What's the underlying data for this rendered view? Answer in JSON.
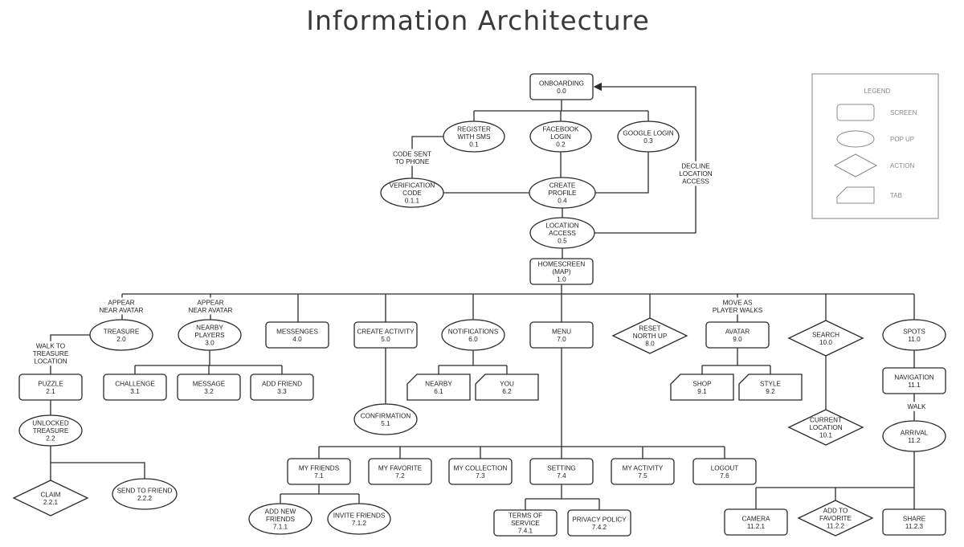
{
  "title": "Information Architecture",
  "legend": {
    "heading": "LEGEND",
    "items": [
      {
        "type": "screen",
        "label": "SCREEN"
      },
      {
        "type": "popup",
        "label": "POP UP"
      },
      {
        "type": "action",
        "label": "ACTION"
      },
      {
        "type": "tab",
        "label": "TAB"
      }
    ]
  },
  "nodes": [
    {
      "id": "0.0",
      "type": "screen",
      "lines": [
        "ONBOARDING",
        "0.0"
      ]
    },
    {
      "id": "0.1",
      "type": "popup",
      "lines": [
        "REGISTER",
        "WITH SMS",
        "0.1"
      ]
    },
    {
      "id": "0.2",
      "type": "popup",
      "lines": [
        "FACEBOOK",
        "LOGIN",
        "0.2"
      ]
    },
    {
      "id": "0.3",
      "type": "popup",
      "lines": [
        "GOOGLE LOGIN",
        "0.3"
      ]
    },
    {
      "id": "0.1.1",
      "type": "popup",
      "lines": [
        "VERIFICATION",
        "CODE",
        "0.1.1"
      ]
    },
    {
      "id": "0.4",
      "type": "popup",
      "lines": [
        "CREATE",
        "PROFILE",
        "0.4"
      ]
    },
    {
      "id": "0.5",
      "type": "popup",
      "lines": [
        "LOCATION",
        "ACCESS",
        "0.5"
      ]
    },
    {
      "id": "1.0",
      "type": "screen",
      "lines": [
        "HOMESCREEN",
        "(MAP)",
        "1.0"
      ]
    },
    {
      "id": "2.0",
      "type": "popup",
      "lines": [
        "TREASURE",
        "2.0"
      ]
    },
    {
      "id": "2.1",
      "type": "screen",
      "lines": [
        "PUZZLE",
        "2.1"
      ]
    },
    {
      "id": "2.2",
      "type": "popup",
      "lines": [
        "UNLOCKED",
        "TREASURE",
        "2.2"
      ]
    },
    {
      "id": "2.2.1",
      "type": "action",
      "lines": [
        "CLAIM",
        "2.2.1"
      ]
    },
    {
      "id": "2.2.2",
      "type": "popup",
      "lines": [
        "SEND TO FRIEND",
        "2.2.2"
      ]
    },
    {
      "id": "3.0",
      "type": "popup",
      "lines": [
        "NEARBY",
        "PLAYERS",
        "3.0"
      ]
    },
    {
      "id": "3.1",
      "type": "screen",
      "lines": [
        "CHALLENGE",
        "3.1"
      ]
    },
    {
      "id": "3.2",
      "type": "screen",
      "lines": [
        "MESSAGE",
        "3.2"
      ]
    },
    {
      "id": "3.3",
      "type": "screen",
      "lines": [
        "ADD FRIEND",
        "3.3"
      ]
    },
    {
      "id": "4.0",
      "type": "screen",
      "lines": [
        "MESSENGES",
        "4.0"
      ]
    },
    {
      "id": "5.0",
      "type": "screen",
      "lines": [
        "CREATE ACTIVITY",
        "5.0"
      ]
    },
    {
      "id": "5.1",
      "type": "popup",
      "lines": [
        "CONFIRMATION",
        "5.1"
      ]
    },
    {
      "id": "6.0",
      "type": "popup",
      "lines": [
        "NOTIFICATIONS",
        "6.0"
      ]
    },
    {
      "id": "6.1",
      "type": "tab",
      "lines": [
        "NEARBY",
        "6.1"
      ]
    },
    {
      "id": "6.2",
      "type": "tab",
      "lines": [
        "YOU",
        "6.2"
      ]
    },
    {
      "id": "7.0",
      "type": "screen",
      "lines": [
        "MENU",
        "7.0"
      ]
    },
    {
      "id": "7.1",
      "type": "screen",
      "lines": [
        "MY FRIENDS",
        "7.1"
      ]
    },
    {
      "id": "7.1.1",
      "type": "popup",
      "lines": [
        "ADD NEW",
        "FRIENDS",
        "7.1.1"
      ]
    },
    {
      "id": "7.1.2",
      "type": "popup",
      "lines": [
        "INVITE FRIENDS",
        "7.1.2"
      ]
    },
    {
      "id": "7.2",
      "type": "screen",
      "lines": [
        "MY FAVORITE",
        "7.2"
      ]
    },
    {
      "id": "7.3",
      "type": "screen",
      "lines": [
        "MY COLLECTION",
        "7.3"
      ]
    },
    {
      "id": "7.4",
      "type": "screen",
      "lines": [
        "SETTING",
        "7.4"
      ]
    },
    {
      "id": "7.4.1",
      "type": "screen",
      "lines": [
        "TERMS OF",
        "SERVICE",
        "7.4.1"
      ]
    },
    {
      "id": "7.4.2",
      "type": "screen",
      "lines": [
        "PRIVACY POLICY",
        "7.4.2"
      ]
    },
    {
      "id": "7.5",
      "type": "screen",
      "lines": [
        "MY ACTIVITY",
        "7.5"
      ]
    },
    {
      "id": "7.6",
      "type": "screen",
      "lines": [
        "LOGOUT",
        "7.6"
      ]
    },
    {
      "id": "8.0",
      "type": "action",
      "lines": [
        "RESET",
        "NORTH UP",
        "8.0"
      ]
    },
    {
      "id": "9.0",
      "type": "screen",
      "lines": [
        "AVATAR",
        "9.0"
      ]
    },
    {
      "id": "9.1",
      "type": "tab",
      "lines": [
        "SHOP",
        "9.1"
      ]
    },
    {
      "id": "9.2",
      "type": "tab",
      "lines": [
        "STYLE",
        "9.2"
      ]
    },
    {
      "id": "10.0",
      "type": "action",
      "lines": [
        "SEARCH",
        "10.0"
      ]
    },
    {
      "id": "10.1",
      "type": "action",
      "lines": [
        "CURRENT",
        "LOCATION",
        "10.1"
      ]
    },
    {
      "id": "11.0",
      "type": "popup",
      "lines": [
        "SPOTS",
        "11.0"
      ]
    },
    {
      "id": "11.1",
      "type": "screen",
      "lines": [
        "NAVIGATION",
        "11.1"
      ]
    },
    {
      "id": "11.2",
      "type": "popup",
      "lines": [
        "ARRIVAL",
        "11.2"
      ]
    },
    {
      "id": "11.2.1",
      "type": "screen",
      "lines": [
        "CAMERA",
        "11.2.1"
      ]
    },
    {
      "id": "11.2.2",
      "type": "action",
      "lines": [
        "ADD TO",
        "FAVORITE",
        "11.2.2"
      ]
    },
    {
      "id": "11.2.3",
      "type": "screen",
      "lines": [
        "SHARE",
        "11.2.3"
      ]
    }
  ],
  "edge_labels": [
    {
      "id": "code-sent",
      "lines": [
        "CODE SENT",
        "TO PHONE"
      ]
    },
    {
      "id": "decline-location",
      "lines": [
        "DECLINE",
        "LOCATION",
        "ACCESS"
      ]
    },
    {
      "id": "appear-treasure",
      "lines": [
        "APPEAR",
        "NEAR AVATAR"
      ]
    },
    {
      "id": "appear-players",
      "lines": [
        "APPEAR",
        "NEAR AVATAR"
      ]
    },
    {
      "id": "walk-to-treasure",
      "lines": [
        "WALK TO",
        "TREASURE",
        "LOCATION"
      ]
    },
    {
      "id": "move-as-player",
      "lines": [
        "MOVE AS",
        "PLAYER WALKS"
      ]
    },
    {
      "id": "walk",
      "lines": [
        "WALK"
      ]
    }
  ]
}
